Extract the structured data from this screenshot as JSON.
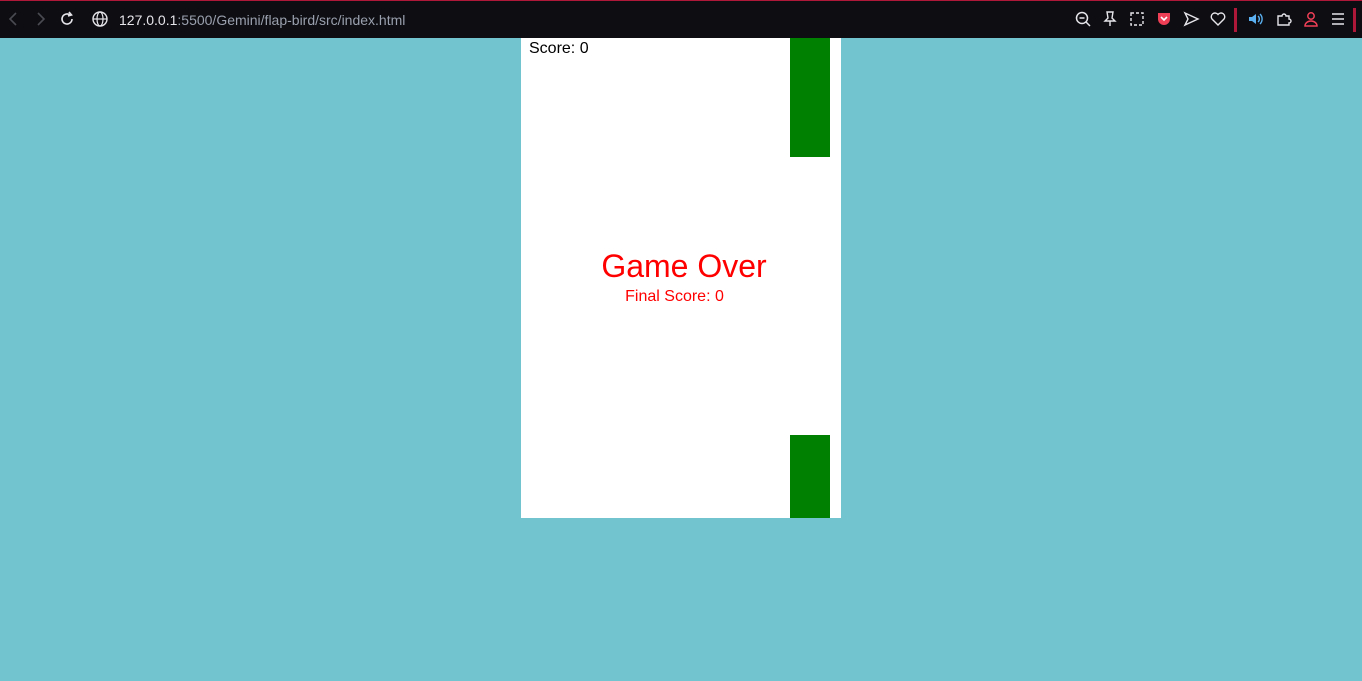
{
  "browser": {
    "url_host": "127.0.0.1",
    "url_path": ":5500/Gemini/flap-bird/src/index.html",
    "icons": {
      "back": "back-icon",
      "forward": "forward-icon",
      "reload": "reload-icon",
      "site_info": "globe-icon",
      "zoom": "zoom-out-icon",
      "pin": "pin-icon",
      "screenshot": "screenshot-icon",
      "pocket": "pocket-icon",
      "send": "send-icon",
      "favorite": "heart-icon",
      "audio": "speaker-icon",
      "extensions": "extensions-icon",
      "profile": "profile-icon",
      "menu": "menu-icon"
    },
    "accent_color": "#b0183a"
  },
  "game": {
    "score_text": "Score: 0",
    "game_over_text": "Game Over",
    "final_score_text": "Final Score: 0",
    "background_color": "#72c5ce",
    "canvas_color": "#ffffff",
    "pipe_color": "#008000",
    "text_color": "#ff0000"
  }
}
